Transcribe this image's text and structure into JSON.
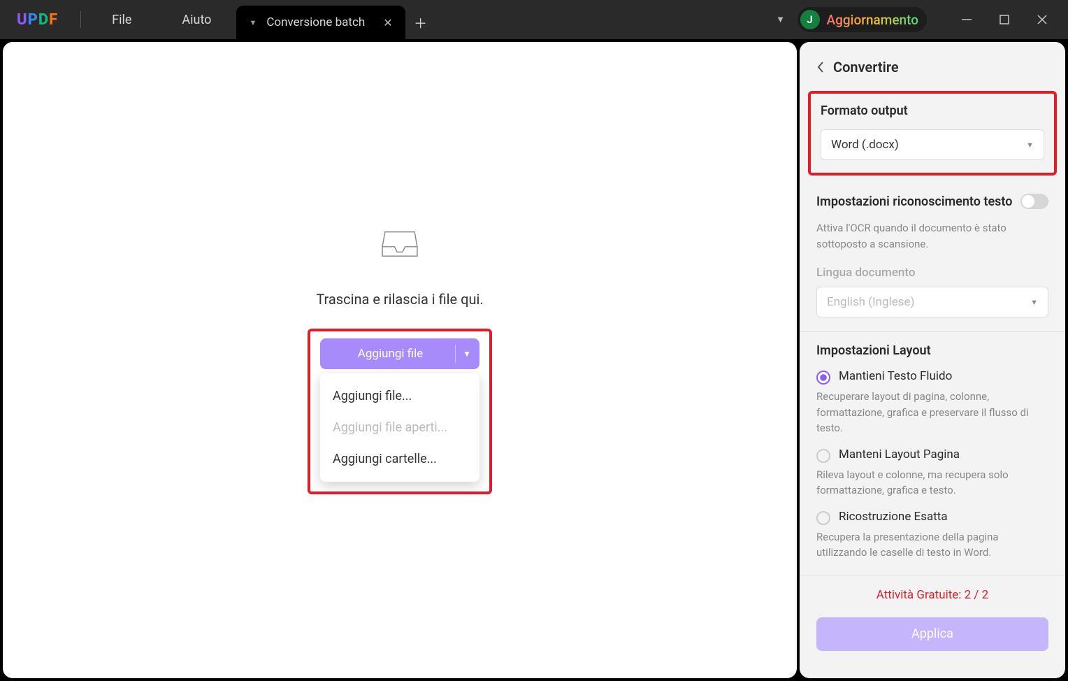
{
  "titlebar": {
    "menu_file": "File",
    "menu_help": "Aiuto",
    "tab_title": "Conversione batch",
    "avatar_letter": "J",
    "user_text": "Aggiornamento"
  },
  "main": {
    "drop_label": "Trascina e rilascia i file qui.",
    "add_button": "Aggiungi file",
    "dropdown": {
      "add_files": "Aggiungi file...",
      "add_open_files": "Aggiungi file aperti...",
      "add_folders": "Aggiungi cartelle..."
    }
  },
  "panel": {
    "title": "Convertire",
    "output_format": {
      "label": "Formato output",
      "value": "Word (.docx)"
    },
    "ocr": {
      "label": "Impostazioni riconoscimento testo",
      "hint": "Attiva l'OCR quando il documento è stato sottoposto a scansione.",
      "lang_label": "Lingua documento",
      "lang_value": "English (Inglese)"
    },
    "layout": {
      "label": "Impostazioni Layout",
      "opt1": {
        "label": "Mantieni Testo Fluido",
        "desc": "Recuperare layout di pagina, colonne, formattazione, grafica e preservare il flusso di testo."
      },
      "opt2": {
        "label": "Manteni Layout Pagina",
        "desc": "Rileva layout e colonne, ma recupera solo formattazione, grafica e testo."
      },
      "opt3": {
        "label": "Ricostruzione Esatta",
        "desc": "Recupera la presentazione della pagina utilizzando le caselle di testo in Word."
      }
    },
    "free_activity": "Attività Gratuite: 2 / 2",
    "apply": "Applica"
  }
}
